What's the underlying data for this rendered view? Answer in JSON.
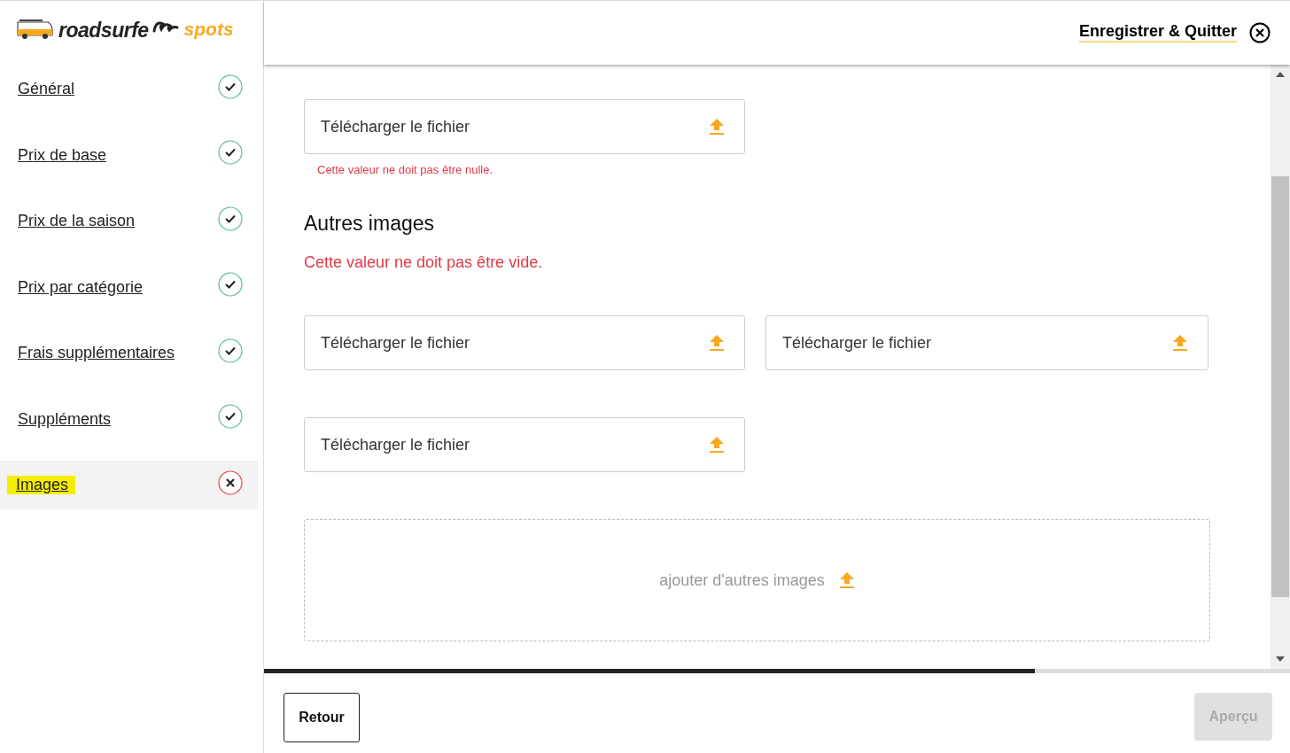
{
  "logo": {
    "brand": "roadsurfe",
    "product": "spots"
  },
  "sidebar": {
    "items": [
      {
        "label": "Général",
        "complete": true,
        "selected": false,
        "highlighted": false
      },
      {
        "label": "Prix de base",
        "complete": true,
        "selected": false,
        "highlighted": false
      },
      {
        "label": "Prix de la saison",
        "complete": true,
        "selected": false,
        "highlighted": false
      },
      {
        "label": "Prix par catégorie",
        "complete": true,
        "selected": false,
        "highlighted": false
      },
      {
        "label": "Frais supplémentaires",
        "complete": true,
        "selected": false,
        "highlighted": false
      },
      {
        "label": "Suppléments",
        "complete": true,
        "selected": false,
        "highlighted": false
      },
      {
        "label": "Images",
        "complete": false,
        "selected": true,
        "highlighted": true
      }
    ]
  },
  "header": {
    "save_quit": "Enregistrer & Quitter"
  },
  "main_image": {
    "upload": "Télécharger le fichier",
    "error": "Cette valeur ne doit pas être nulle."
  },
  "other_images": {
    "title": "Autres images",
    "error": "Cette valeur ne doit pas être vide.",
    "uploads": [
      "Télécharger le fichier",
      "Télécharger le fichier",
      "Télécharger le fichier"
    ],
    "add_more": "ajouter d'autres images"
  },
  "progress": {
    "level": 0.751
  },
  "footer": {
    "back": "Retour",
    "preview": "Aperçu",
    "preview_disabled": true
  }
}
